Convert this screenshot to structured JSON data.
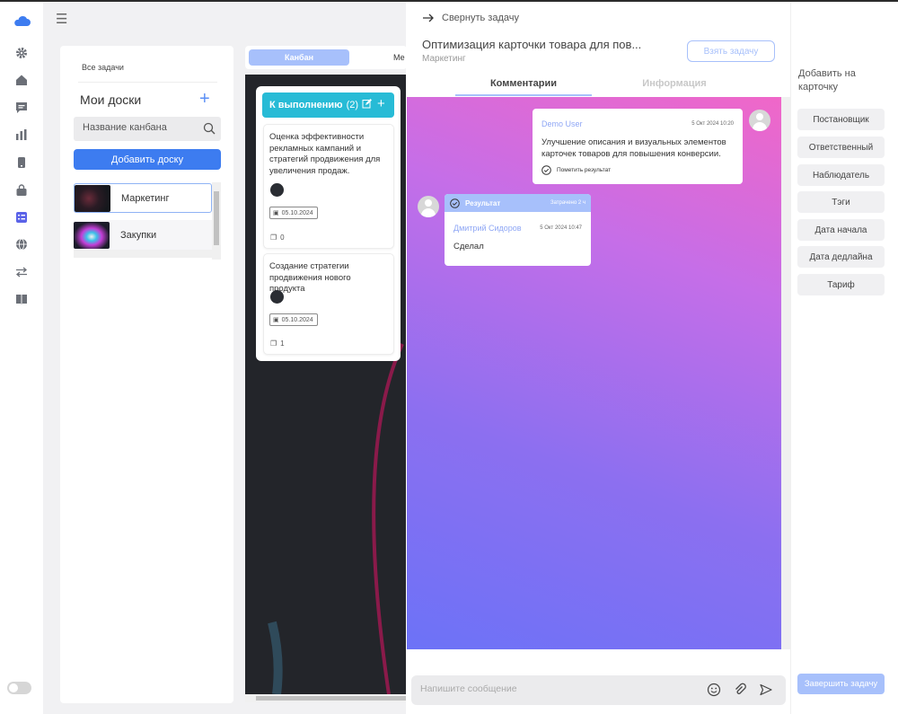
{
  "sidebar": {
    "icons": [
      "cloud-logo-icon",
      "gear-icon",
      "home-icon",
      "chat-icon",
      "chart-icon",
      "phone-icon",
      "bag-icon",
      "tasks-icon",
      "globe-icon",
      "exchange-icon",
      "book-icon"
    ]
  },
  "boards_panel": {
    "breadcrumb": "Все задачи",
    "title": "Мои доски",
    "search_placeholder": "Название канбана",
    "add_button": "Добавить доску",
    "boards": [
      {
        "name": "Маркетинг",
        "active": true
      },
      {
        "name": "Закупки",
        "active": false
      }
    ]
  },
  "view_tabs": {
    "active": "Канбан",
    "other": "Ме"
  },
  "kanban": {
    "column_title": "К выполнению",
    "column_count": "(2)",
    "cards": [
      {
        "title": "Оценка эффективности рекламных кампаний и стратегий продвижения для увеличения продаж.",
        "date": "05.10.2024",
        "comments": "0"
      },
      {
        "title": "Создание стратегии продвижения нового продукта",
        "date": "05.10.2024",
        "comments": "1"
      }
    ]
  },
  "task": {
    "collapse_label": "Свернуть задачу",
    "title": "Оптимизация карточки товара для пов...",
    "board": "Маркетинг",
    "take_button": "Взять задачу",
    "tabs": {
      "comments": "Комментарии",
      "info": "Информация"
    },
    "messages": [
      {
        "author": "Demo User",
        "time": "5 Окт 2024 10:20",
        "text": "Улучшение описания и визуальных элементов карточек товаров для повышения конверсии.",
        "action": "Пометить результат"
      },
      {
        "header": "Результат",
        "spent": "Затрачено 2 ч",
        "author": "Дмитрий Сидоров",
        "time": "5 Окт 2024 10:47",
        "text": "Сделал"
      }
    ],
    "compose_placeholder": "Напишите сообщение"
  },
  "right_panel": {
    "title": "Добавить на карточку",
    "buttons": [
      "Постановщик",
      "Ответственный",
      "Наблюдатель",
      "Тэги",
      "Дата начала",
      "Дата дедлайна",
      "Тариф"
    ],
    "finish_button": "Завершить задачу"
  },
  "colors": {
    "accent": "#3d7cf0",
    "accent_light": "#a7c0fb",
    "column_head": "#27bbd6"
  }
}
